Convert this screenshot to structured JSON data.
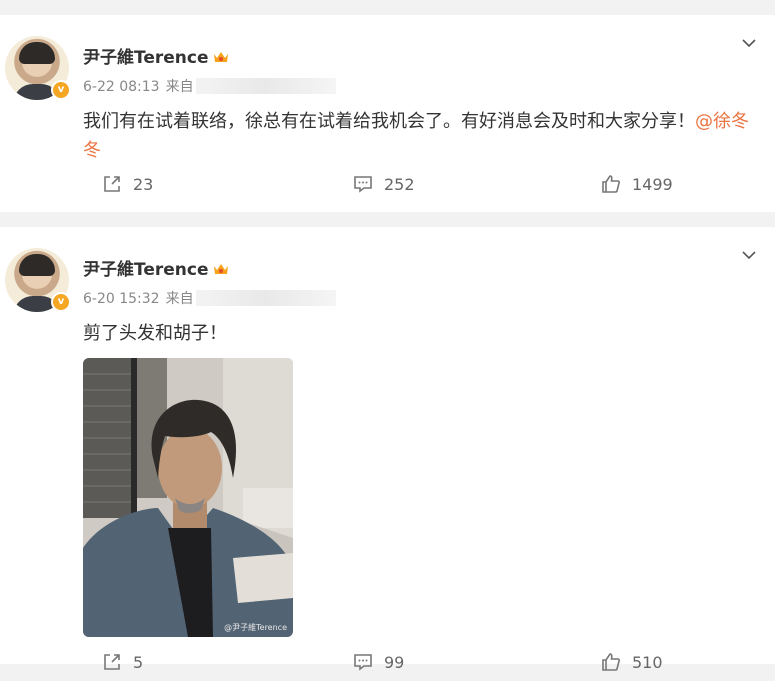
{
  "posts": [
    {
      "author": "尹子維Terence",
      "time": "6-22 08:13",
      "source_label": "来自",
      "text": "我们有在试着联络，徐总有在试着给我机会了。有好消息会及时和大家分享！",
      "mention": "@徐冬冬",
      "reposts": "23",
      "comments": "252",
      "likes": "1499"
    },
    {
      "author": "尹子維Terence",
      "time": "6-20 15:32",
      "source_label": "来自",
      "text": "剪了头发和胡子！",
      "image_watermark": "@尹子維Terence",
      "reposts": "5",
      "comments": "99",
      "likes": "510"
    }
  ],
  "icons": {
    "repost": "repost-icon",
    "comment": "comment-icon",
    "like": "like-icon",
    "more": "chevron-down-icon",
    "crown": "crown-badge-icon",
    "verified": "verified-badge-icon"
  },
  "colors": {
    "mention": "#eb7340",
    "verified": "#f5a623",
    "background": "#f2f2f2"
  }
}
